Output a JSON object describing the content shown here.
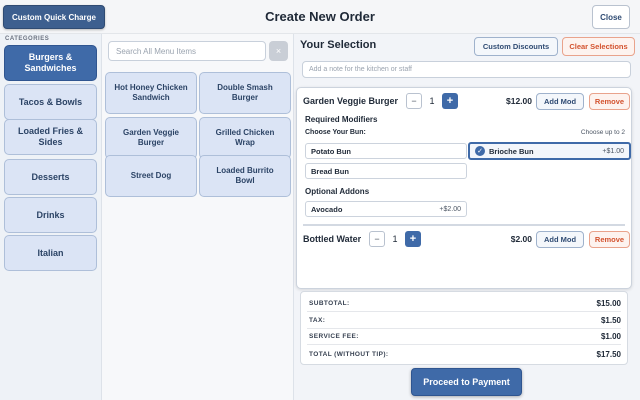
{
  "header": {
    "custom_charge_label": "Custom Quick Charge",
    "title": "Create New Order",
    "close_label": "Close"
  },
  "categories": {
    "heading": "CATEGORIES",
    "items": [
      {
        "label": "Burgers & Sandwiches",
        "active": true
      },
      {
        "label": "Tacos & Bowls",
        "active": false
      },
      {
        "label": "Loaded Fries & Sides",
        "active": false
      },
      {
        "label": "Desserts",
        "active": false
      },
      {
        "label": "Drinks",
        "active": false
      },
      {
        "label": "Italian",
        "active": false
      }
    ]
  },
  "menu": {
    "search_placeholder": "Search All Menu Items",
    "clear_icon": "×",
    "items": [
      {
        "label": "Hot Honey Chicken Sandwich"
      },
      {
        "label": "Double Smash Burger"
      },
      {
        "label": "Garden Veggie Burger"
      },
      {
        "label": "Grilled Chicken Wrap"
      },
      {
        "label": "Street Dog"
      },
      {
        "label": "Loaded Burrito Bowl"
      }
    ]
  },
  "selection": {
    "title": "Your Selection",
    "custom_discounts_label": "Custom Discounts",
    "clear_selections_label": "Clear Selections",
    "note_placeholder": "Add a note for the kitchen or staff",
    "items": [
      {
        "name": "Garden Veggie Burger",
        "qty": "1",
        "price": "$12.00",
        "add_mod_label": "Add Mod",
        "remove_label": "Remove",
        "minus_label": "−",
        "plus_label": "+"
      },
      {
        "name": "Bottled Water",
        "qty": "1",
        "price": "$2.00",
        "add_mod_label": "Add Mod",
        "remove_label": "Remove",
        "minus_label": "−",
        "plus_label": "+"
      }
    ],
    "modifiers": {
      "required_heading": "Required Modifiers",
      "bun_heading": "Choose Your Bun:",
      "bun_hint": "Choose up to 2",
      "bun_options": [
        {
          "label": "Potato Bun",
          "price": "",
          "selected": false
        },
        {
          "label": "Brioche Bun",
          "price": "+$1.00",
          "selected": true
        },
        {
          "label": "Bread Bun",
          "price": "",
          "selected": false
        }
      ],
      "optional_heading": "Optional Addons",
      "addons": [
        {
          "label": "Avocado",
          "price": "+$2.00",
          "selected": false
        }
      ]
    }
  },
  "totals": {
    "subtotal_label": "SUBTOTAL:",
    "subtotal_value": "$15.00",
    "tax_label": "TAX:",
    "tax_value": "$1.50",
    "fee_label": "SERVICE FEE:",
    "fee_value": "$1.00",
    "total_label": "TOTAL (WITHOUT TIP):",
    "total_value": "$17.50"
  },
  "proceed_label": "Proceed to Payment",
  "colors": {
    "accent": "#3f6aa8",
    "danger": "#d3532f",
    "chip": "#dbe4f5"
  }
}
